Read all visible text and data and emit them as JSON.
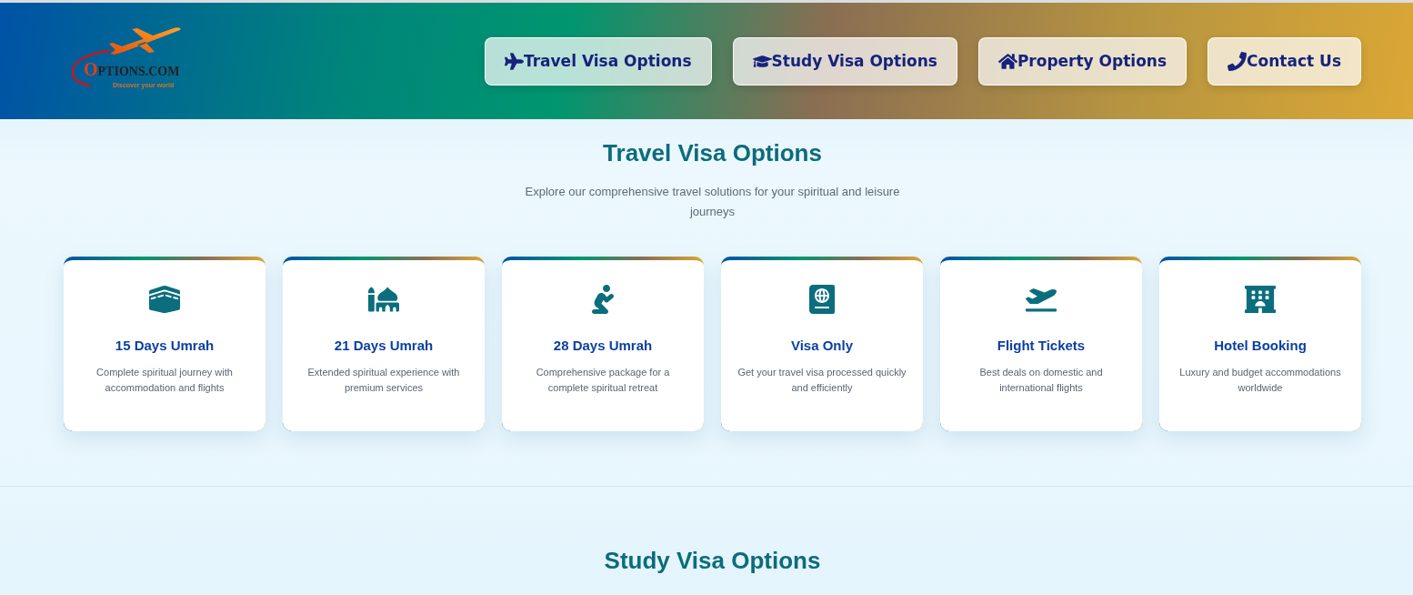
{
  "header": {
    "logo": {
      "name": "OPTIONS.COM",
      "tagline": "Discover your world"
    },
    "nav": [
      "Travel Visa Options",
      "Study Visa Options",
      "Property Options",
      "Contact Us"
    ]
  },
  "sections": [
    {
      "title": "Travel Visa Options",
      "subtitle": "Explore our comprehensive travel solutions for your spiritual and leisure journeys",
      "cards": [
        {
          "title": "15 Days Umrah",
          "description": "Complete spiritual journey with accommodation and flights"
        },
        {
          "title": "21 Days Umrah",
          "description": "Extended spiritual experience with premium services"
        },
        {
          "title": "28 Days Umrah",
          "description": "Comprehensive package for a complete spiritual retreat"
        },
        {
          "title": "Visa Only",
          "description": "Get your travel visa processed quickly and efficiently"
        },
        {
          "title": "Flight Tickets",
          "description": "Best deals on domestic and international flights"
        },
        {
          "title": "Hotel Booking",
          "description": "Luxury and budget accommodations worldwide"
        }
      ]
    },
    {
      "title": "Study Visa Options"
    }
  ]
}
